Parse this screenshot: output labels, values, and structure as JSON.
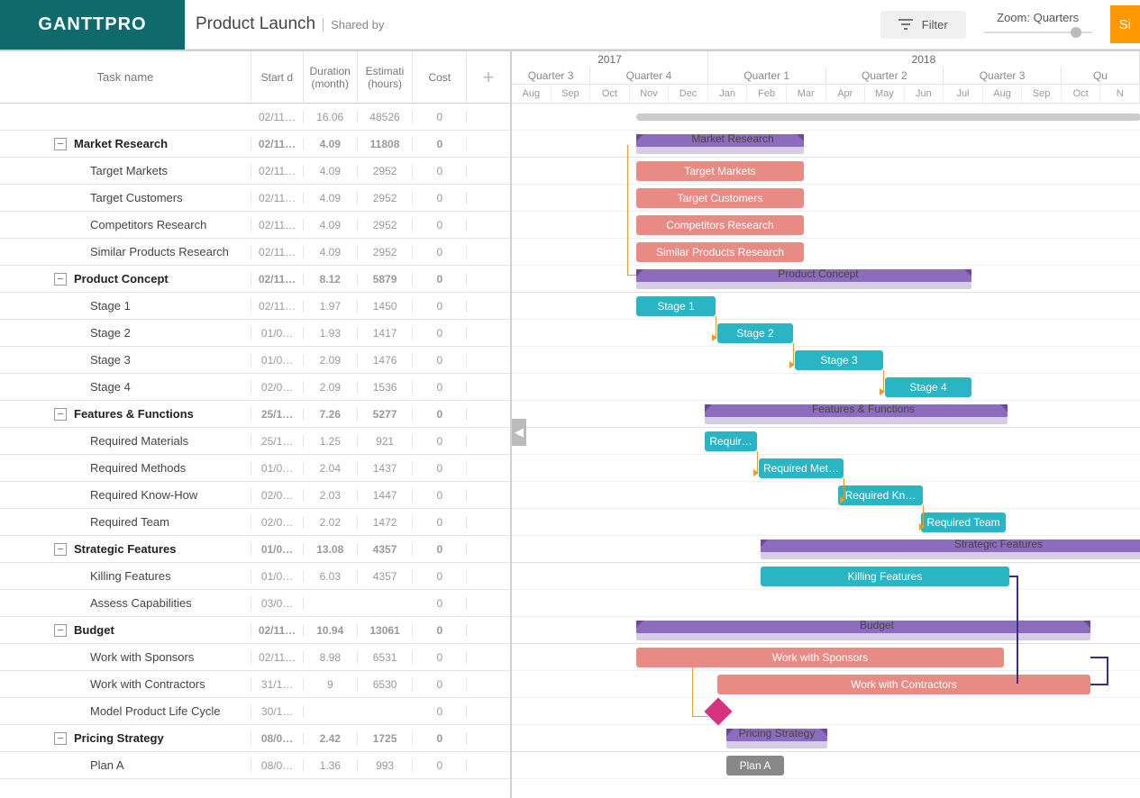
{
  "logo": "GANTTPRO",
  "title": "Product Launch",
  "shared": "Shared by",
  "filter": "Filter",
  "zoom": "Zoom: Quarters",
  "signup": "Si",
  "cols": {
    "name": "Task name",
    "start": "Start d",
    "dur1": "Duration",
    "dur2": "(month)",
    "est1": "Estimati",
    "est2": "(hours)",
    "cost": "Cost"
  },
  "timeline": {
    "years": [
      {
        "label": "2017",
        "months": 5
      },
      {
        "label": "2018",
        "months": 11
      }
    ],
    "quarters": [
      {
        "label": "Quarter 3",
        "months": 2
      },
      {
        "label": "Quarter 4",
        "months": 3
      },
      {
        "label": "Quarter 1",
        "months": 3
      },
      {
        "label": "Quarter 2",
        "months": 3
      },
      {
        "label": "Quarter 3",
        "months": 3
      },
      {
        "label": "Qu",
        "months": 2
      }
    ],
    "months": [
      "Aug",
      "Sep",
      "Oct",
      "Nov",
      "Dec",
      "Jan",
      "Feb",
      "Mar",
      "Apr",
      "May",
      "Jun",
      "Jul",
      "Aug",
      "Sep",
      "Oct",
      "N"
    ]
  },
  "rows": [
    {
      "type": "project",
      "name": "",
      "start": "02/11…",
      "dur": "16.06",
      "est": "48526",
      "cost": "0"
    },
    {
      "type": "group",
      "name": "Market Research",
      "start": "02/11…",
      "dur": "4.09",
      "est": "11808",
      "cost": "0"
    },
    {
      "type": "task",
      "indent": 3,
      "name": "Target Markets",
      "start": "02/11…",
      "dur": "4.09",
      "est": "2952",
      "cost": "0"
    },
    {
      "type": "task",
      "indent": 3,
      "name": "Target Customers",
      "start": "02/11…",
      "dur": "4.09",
      "est": "2952",
      "cost": "0"
    },
    {
      "type": "task",
      "indent": 3,
      "name": "Competitors Research",
      "start": "02/11…",
      "dur": "4.09",
      "est": "2952",
      "cost": "0"
    },
    {
      "type": "task",
      "indent": 3,
      "name": "Similar Products Research",
      "start": "02/11…",
      "dur": "4.09",
      "est": "2952",
      "cost": "0"
    },
    {
      "type": "group",
      "name": "Product Concept",
      "start": "02/11…",
      "dur": "8.12",
      "est": "5879",
      "cost": "0"
    },
    {
      "type": "task",
      "indent": 3,
      "name": "Stage 1",
      "start": "02/11…",
      "dur": "1.97",
      "est": "1450",
      "cost": "0"
    },
    {
      "type": "task",
      "indent": 3,
      "name": "Stage 2",
      "start": "01/0…",
      "dur": "1.93",
      "est": "1417",
      "cost": "0"
    },
    {
      "type": "task",
      "indent": 3,
      "name": "Stage 3",
      "start": "01/0…",
      "dur": "2.09",
      "est": "1476",
      "cost": "0"
    },
    {
      "type": "task",
      "indent": 3,
      "name": "Stage 4",
      "start": "02/0…",
      "dur": "2.09",
      "est": "1536",
      "cost": "0"
    },
    {
      "type": "group",
      "name": "Features & Functions",
      "start": "25/1…",
      "dur": "7.26",
      "est": "5277",
      "cost": "0"
    },
    {
      "type": "task",
      "indent": 3,
      "name": "Required Materials",
      "start": "25/1…",
      "dur": "1.25",
      "est": "921",
      "cost": "0"
    },
    {
      "type": "task",
      "indent": 3,
      "name": "Required Methods",
      "start": "01/0…",
      "dur": "2.04",
      "est": "1437",
      "cost": "0"
    },
    {
      "type": "task",
      "indent": 3,
      "name": "Required Know-How",
      "start": "02/0…",
      "dur": "2.03",
      "est": "1447",
      "cost": "0"
    },
    {
      "type": "task",
      "indent": 3,
      "name": "Required Team",
      "start": "02/0…",
      "dur": "2.02",
      "est": "1472",
      "cost": "0"
    },
    {
      "type": "group",
      "name": "Strategic Features",
      "start": "01/0…",
      "dur": "13.08",
      "est": "4357",
      "cost": "0"
    },
    {
      "type": "task",
      "indent": 3,
      "name": "Killing Features",
      "start": "01/0…",
      "dur": "6.03",
      "est": "4357",
      "cost": "0"
    },
    {
      "type": "task",
      "indent": 3,
      "name": "Assess Capabilities",
      "start": "03/0…",
      "dur": "",
      "est": "",
      "cost": "0"
    },
    {
      "type": "group",
      "name": "Budget",
      "start": "02/11…",
      "dur": "10.94",
      "est": "13061",
      "cost": "0"
    },
    {
      "type": "task",
      "indent": 3,
      "name": "Work with Sponsors",
      "start": "02/11…",
      "dur": "8.98",
      "est": "6531",
      "cost": "0"
    },
    {
      "type": "task",
      "indent": 3,
      "name": "Work with Contractors",
      "start": "31/1…",
      "dur": "9",
      "est": "6530",
      "cost": "0"
    },
    {
      "type": "task",
      "indent": 3,
      "name": "Model Product Life Cycle",
      "start": "30/1…",
      "dur": "",
      "est": "",
      "cost": "0"
    },
    {
      "type": "group",
      "name": "Pricing Strategy",
      "start": "08/0…",
      "dur": "2.42",
      "est": "1725",
      "cost": "0"
    },
    {
      "type": "task",
      "indent": 3,
      "name": "Plan A",
      "start": "08/0…",
      "dur": "1.36",
      "est": "993",
      "cost": "0"
    }
  ],
  "bars": {
    "mr_summary": "Market Research",
    "target_markets": "Target Markets",
    "target_customers": "Target Customers",
    "competitors": "Competitors Research",
    "similar": "Similar Products Research",
    "pc_summary": "Product Concept",
    "stage1": "Stage 1",
    "stage2": "Stage 2",
    "stage3": "Stage 3",
    "stage4": "Stage 4",
    "ff_summary": "Features & Functions",
    "req_mat": "Requir…",
    "req_met": "Required Met…",
    "req_kh": "Required Kn…",
    "req_team": "Required Team",
    "sf_summary": "Strategic Features",
    "killing": "Killing Features",
    "budget_summary": "Budget",
    "sponsors": "Work with Sponsors",
    "contractors": "Work with Contractors",
    "ps_summary": "Pricing Strategy",
    "plan_a": "Plan A"
  }
}
